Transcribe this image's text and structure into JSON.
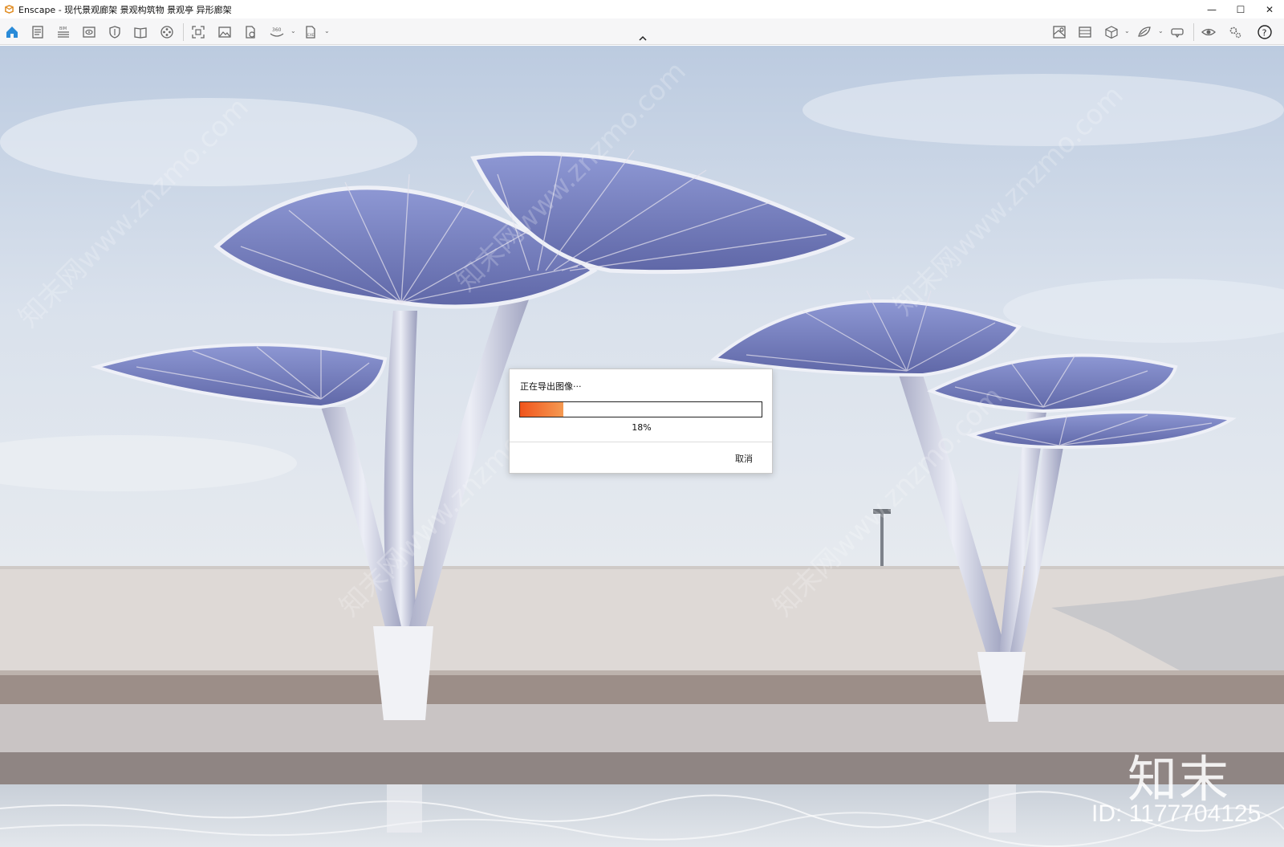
{
  "window": {
    "title": "Enscape - 现代景观廊架 景观构筑物 景观亭 异形廊架",
    "controls": [
      "—",
      "☐",
      "✕"
    ]
  },
  "toolbar": {
    "left_icons": [
      "home-icon",
      "notes-icon",
      "bim-icon",
      "view-icon",
      "shield-icon",
      "book-icon",
      "film-reel-icon",
      "screenshot-icon",
      "image-export-icon",
      "batch-export-icon",
      "panorama-icon",
      "exe-export-icon"
    ],
    "right_icons": [
      "map-icon",
      "gallery-icon",
      "cube-icon",
      "asset-icon",
      "vr-headset-icon",
      "eye-icon",
      "settings-icon",
      "help-icon"
    ]
  },
  "dialog": {
    "title": "正在导出图像···",
    "progress": 0.18,
    "progress_label": "18%",
    "cancel_label": "取消"
  },
  "watermark": {
    "logo": "知末",
    "id_text": "ID: 1177704125",
    "diagonal_text": "知末网www.znzmo.com"
  },
  "colors": {
    "accent": "#f0541c",
    "sky": "#c9d6e8",
    "toolbar_bg": "#f6f6f7"
  }
}
